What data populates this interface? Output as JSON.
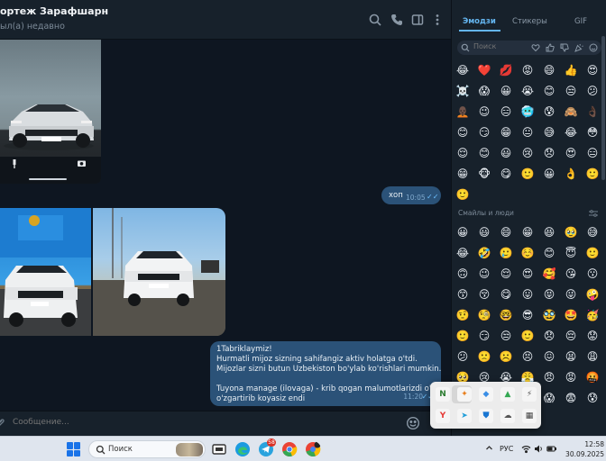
{
  "chat": {
    "title": "ортеж Зарафшарн",
    "status": "ыл(а) недавно"
  },
  "messages": {
    "hop": {
      "text": "хоп",
      "time": "10:05"
    },
    "long": {
      "lines": [
        "1Tabriklaymiz!",
        "Hurmatli mijoz sizning sahifangiz aktiv holatga o'tdi.",
        "Mijozlar sizni butun Uzbekiston bo'ylab ko'rishlari mumkin.",
        "",
        "Tuyona manage (ilovaga) - krib qogan malumotlarizdi o'ziz",
        "o'zgartirib koyasiz endi"
      ],
      "time": "11:20"
    }
  },
  "composer": {
    "placeholder": "Сообщение..."
  },
  "emoji_panel": {
    "tabs": [
      "Эмодзи",
      "Стикеры",
      "GIF"
    ],
    "search_placeholder": "Поиск",
    "section_people": "Смайлы и люди",
    "recent": [
      "😂",
      "❤️",
      "💋",
      "😡",
      "😄",
      "👍",
      "😍",
      "☠️",
      "😱",
      "😀",
      "😭",
      "😊",
      "😒",
      "😕",
      "🧑🏿‍🦲",
      "😉",
      "😑",
      "🥶",
      "😰",
      "🙈",
      "👌🏿",
      "😊",
      "😏",
      "😁",
      "😐",
      "😅",
      "😂",
      "😳",
      "😌",
      "😊",
      "😃",
      "😢",
      "😞",
      "😍",
      "😑",
      "😁",
      "🐵",
      "😋",
      "🙂",
      "😀",
      "👌",
      "🙂",
      "🙂"
    ],
    "people": [
      "😀",
      "😃",
      "😄",
      "😁",
      "😆",
      "🥹",
      "😅",
      "😂",
      "🤣",
      "🥲",
      "☺️",
      "😊",
      "😇",
      "🙂",
      "🙃",
      "😉",
      "😌",
      "😍",
      "🥰",
      "😘",
      "😗",
      "😙",
      "😚",
      "😋",
      "😛",
      "😝",
      "😜",
      "🤪",
      "🤨",
      "🧐",
      "🤓",
      "😎",
      "🥸",
      "🤩",
      "🥳",
      "🙂",
      "😏",
      "😒",
      "🙂",
      "😞",
      "😔",
      "😟",
      "😕",
      "🙁",
      "☹️",
      "😣",
      "😖",
      "😫",
      "😩",
      "🥺",
      "😢",
      "😭",
      "😤",
      "😠",
      "😡",
      "🤬",
      "🤯",
      "😳",
      "🥵",
      "🥶",
      "😱",
      "😨",
      "😰",
      "😥",
      "😓"
    ]
  },
  "tray_popup": {
    "apps": [
      {
        "label": "N",
        "color": "#2d7d32"
      },
      {
        "label": "✦",
        "color": "#e87f1e"
      },
      {
        "label": "◆",
        "color": "#3a8ee6"
      },
      {
        "label": "▲",
        "color": "#34a853"
      },
      {
        "label": "⚡",
        "color": "#555555"
      },
      {
        "label": "Y",
        "color": "#e53935"
      },
      {
        "label": "➤",
        "color": "#229ed9"
      },
      {
        "label": "⛊",
        "color": "#1976d2"
      },
      {
        "label": "☁",
        "color": "#555555"
      },
      {
        "label": "▦",
        "color": "#444444"
      }
    ]
  },
  "taskbar": {
    "search_label": "Поиск",
    "badge": "58",
    "lang": "РУС",
    "time": "12:58",
    "date": "30.09.2025"
  }
}
